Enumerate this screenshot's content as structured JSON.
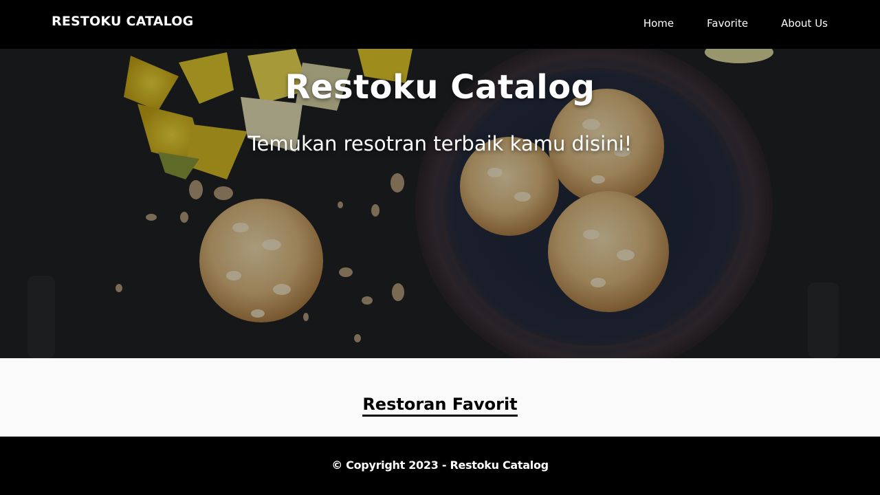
{
  "navbar": {
    "brand": "RESTOKU CATALOG",
    "links": [
      "Home",
      "Favorite",
      "About Us"
    ]
  },
  "hero": {
    "title": "Restoku Catalog",
    "subtitle": "Temukan resotran terbaik kamu disini!",
    "image_subject": "almond cookies in a dark bowl with yellow daffodils"
  },
  "main": {
    "section_title": "Restoran Favorit"
  },
  "footer": {
    "copyright": "© Copyright 2023 - Restoku Catalog"
  },
  "colors": {
    "navbar_bg": "#000000",
    "footer_bg": "#000000",
    "content_bg": "#fafafa",
    "text_light": "#ffffff"
  }
}
